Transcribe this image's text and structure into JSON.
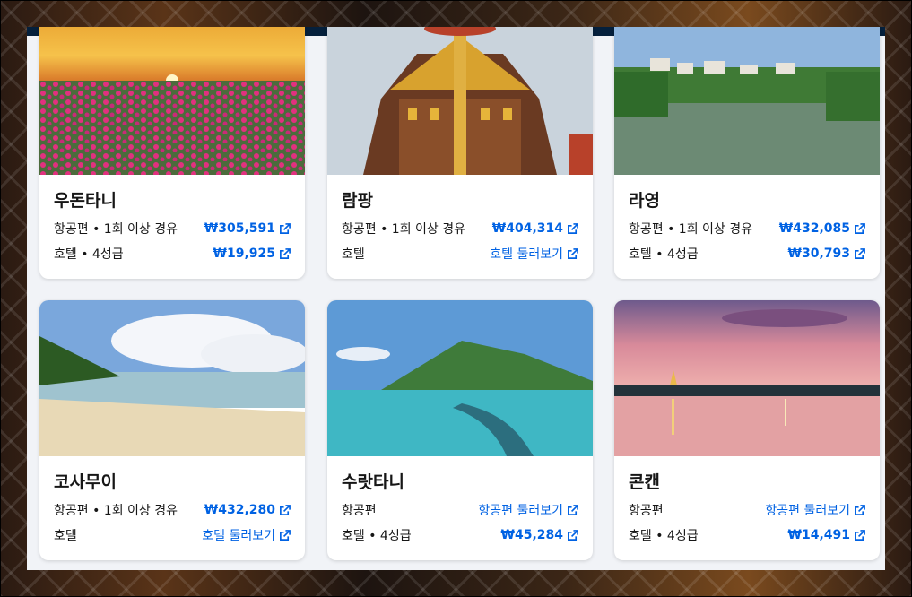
{
  "colors": {
    "accent": "#0062e3",
    "header": "#05203c",
    "panel": "#f1f3f7"
  },
  "cards": [
    {
      "name": "우돈타니",
      "flight_label": "항공편 • 1회 이상 경유",
      "flight_price": "₩305,591",
      "hotel_label": "호텔 • 4성급",
      "hotel_price": "₩19,925"
    },
    {
      "name": "람팡",
      "flight_label": "항공편 • 1회 이상 경유",
      "flight_price": "₩404,314",
      "hotel_label": "호텔",
      "hotel_link": "호텔 둘러보기"
    },
    {
      "name": "라영",
      "flight_label": "항공편 • 1회 이상 경유",
      "flight_price": "₩432,085",
      "hotel_label": "호텔 • 4성급",
      "hotel_price": "₩30,793"
    },
    {
      "name": "코사무이",
      "flight_label": "항공편 • 1회 이상 경유",
      "flight_price": "₩432,280",
      "hotel_label": "호텔",
      "hotel_link": "호텔 둘러보기"
    },
    {
      "name": "수랏타니",
      "flight_label": "항공편",
      "flight_link": "항공편 둘러보기",
      "hotel_label": "호텔 • 4성급",
      "hotel_price": "₩45,284"
    },
    {
      "name": "콘캔",
      "flight_label": "항공편",
      "flight_link": "항공편 둘러보기",
      "hotel_label": "호텔 • 4성급",
      "hotel_price": "₩14,491"
    }
  ],
  "icons": {
    "external": "external-link-icon"
  }
}
